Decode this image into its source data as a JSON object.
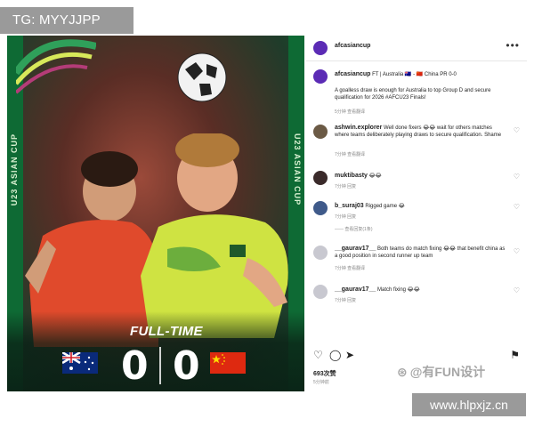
{
  "watermark_top": "TG: MYYJJPP",
  "watermark_bottom": "www.hlpxjz.cn",
  "watermark_mid": "@有FUN设计",
  "photo": {
    "side_text_left": "U23 ASIAN CUP",
    "side_text_right": "U23 ASIAN CUP",
    "full_time": "FULL-TIME",
    "score_home": "0",
    "score_away": "0",
    "home_flag": "Australia",
    "away_flag": "China PR"
  },
  "post": {
    "account": "afcasiancup",
    "more_icon": "more-dots-icon",
    "caption_user": "afcasiancup",
    "caption_line1": "FT | Australia 🇦🇺 - 🇨🇳 China PR 0-0",
    "caption_line2": "A goalless draw is enough for Australia to top Group D and secure qualification for 2026 #AFCU23 Finals!",
    "caption_meta": "5分钟    查看翻译",
    "likes": "693次赞",
    "date": "5分钟前"
  },
  "comments": [
    {
      "user": "ashwin.explorer",
      "text": "Well done fixers 😂😂 wait for others matches where teams deliberately playing draws to secure qualification. Shame",
      "meta": "7分钟    查看翻译",
      "avatar_color": "#6b5a45"
    },
    {
      "user": "muktibasty",
      "text": "😂😂",
      "meta": "7分钟    回复",
      "avatar_color": "#3a2a2a"
    },
    {
      "user": "b_suraj03",
      "text": "Rigged game 😂",
      "meta": "7分钟    回复",
      "avatar_color": "#3f5a8a",
      "replies": "—— 查看回复(1条)"
    },
    {
      "user": "__gaurav17__",
      "text": "Both teams do match fixing 😂😂 that benefit china as a good position in second runner up team",
      "meta": "7分钟    查看翻译",
      "avatar_color": "#c8c8d0"
    },
    {
      "user": "__gaurav17__",
      "text": "Match fixing 😂😂",
      "meta": "7分钟    回复",
      "avatar_color": "#c8c8d0"
    }
  ],
  "colors": {
    "frame_green": "#0e6a34",
    "watermark_gray": "#9a9a9a",
    "ig_avatar": "#5b2bb5"
  }
}
